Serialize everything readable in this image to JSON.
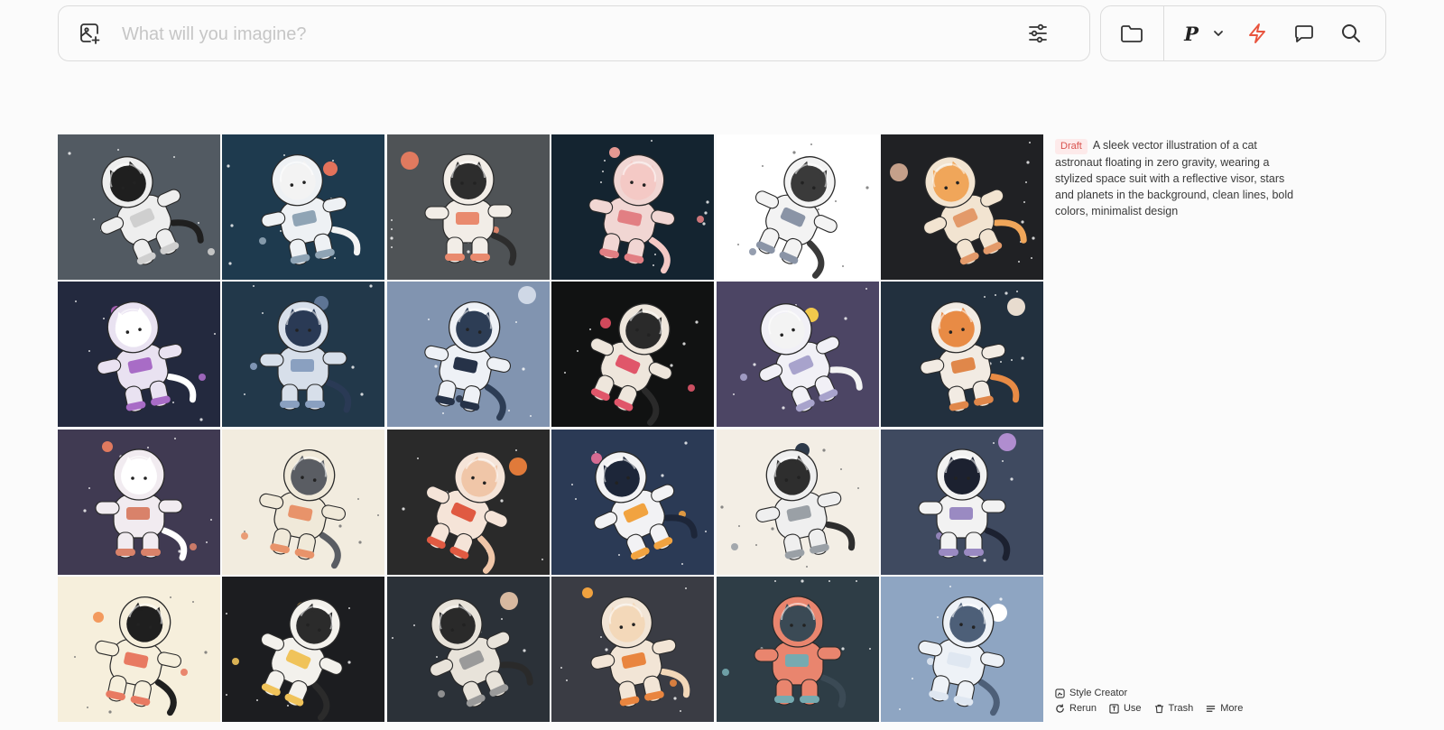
{
  "search": {
    "placeholder": "What will you imagine?",
    "value": ""
  },
  "toolbar": {
    "model_letter": "P",
    "icons": [
      "image-add-icon",
      "sliders-icon",
      "folder-icon",
      "chevron-down-icon",
      "lightning-icon",
      "chat-bubble-icon",
      "search-icon"
    ],
    "accent": "#e8543e"
  },
  "job": {
    "badge": "Draft",
    "prompt": "A sleek vector illustration of a cat astronaut floating in zero gravity, wearing a stylized space suit with a reflective visor, stars and planets in the background, clean lines, bold colors, minimalist design"
  },
  "actions": {
    "style_creator": "Style Creator",
    "rerun": "Rerun",
    "use": "Use",
    "trash": "Trash",
    "more": "More"
  },
  "images": [
    {
      "bg": "#525a62",
      "suit": "#eeeeee",
      "cat": "#1f1f1f",
      "accent": "#cfcfcf",
      "planet": "#9aa3ab"
    },
    {
      "bg": "#1e3a4e",
      "suit": "#eef1f4",
      "cat": "#f3f3f3",
      "accent": "#8fa4b5",
      "planet": "#e2725b"
    },
    {
      "bg": "#4f5356",
      "suit": "#f2ede7",
      "cat": "#2d2d2d",
      "accent": "#e98a6e",
      "planet": "#e07a5f"
    },
    {
      "bg": "#142430",
      "suit": "#f1d6d3",
      "cat": "#f4c9c5",
      "accent": "#e27f83",
      "planet": "#e59892"
    },
    {
      "bg": "#ffffff",
      "suit": "#f3f3f3",
      "cat": "#3a3a3a",
      "accent": "#8a94a6",
      "planet": "#c7cdd8"
    },
    {
      "bg": "#202124",
      "suit": "#f2e4d1",
      "cat": "#f0a65a",
      "accent": "#e39a6a",
      "planet": "#c5a08a"
    },
    {
      "bg": "#23293e",
      "suit": "#e9e2f1",
      "cat": "#ffffff",
      "accent": "#a86cc6",
      "planet": "#a35fb0"
    },
    {
      "bg": "#22384a",
      "suit": "#d7dfea",
      "cat": "#2a3a55",
      "accent": "#8aa0c0",
      "planet": "#5e7595"
    },
    {
      "bg": "#8194b0",
      "suit": "#eef1f6",
      "cat": "#2d3d55",
      "accent": "#263248",
      "planet": "#cfd8e6"
    },
    {
      "bg": "#111212",
      "suit": "#eee6dc",
      "cat": "#2a2a2a",
      "accent": "#e0566a",
      "planet": "#d1495b"
    },
    {
      "bg": "#4c4564",
      "suit": "#f1f0f6",
      "cat": "#f3f3f3",
      "accent": "#a8a3cc",
      "planet": "#f2c94c"
    },
    {
      "bg": "#22303e",
      "suit": "#f2ebe3",
      "cat": "#e88b45",
      "accent": "#e0874a",
      "planet": "#e8dccf"
    },
    {
      "bg": "#403a52",
      "suit": "#f1ebf0",
      "cat": "#ffffff",
      "accent": "#d9826a",
      "planet": "#e07a5f"
    },
    {
      "bg": "#f2ecdf",
      "suit": "#f0e9d9",
      "cat": "#5a5d63",
      "accent": "#e8936a",
      "planet": "#f09257"
    },
    {
      "bg": "#2a2a2a",
      "suit": "#f5e4d8",
      "cat": "#f0c6a8",
      "accent": "#e05a42",
      "planet": "#e07a3a"
    },
    {
      "bg": "#2b3a55",
      "suit": "#f2f2f4",
      "cat": "#1d2639",
      "accent": "#f1a340",
      "planet": "#d56b93"
    },
    {
      "bg": "#f3eee5",
      "suit": "#efefef",
      "cat": "#2e2e2e",
      "accent": "#9aa0a6",
      "planet": "#2e3a4a"
    },
    {
      "bg": "#3f4a60",
      "suit": "#f2f2f2",
      "cat": "#1c2130",
      "accent": "#9a8ac2",
      "planet": "#b08dcf"
    },
    {
      "bg": "#f6efdc",
      "suit": "#f6efdc",
      "cat": "#1f1f1f",
      "accent": "#e87a62",
      "planet": "#f39a5e"
    },
    {
      "bg": "#1c1d20",
      "suit": "#f3f1ec",
      "cat": "#2b2b2b",
      "accent": "#f0c35a",
      "planet": "#e9b84f"
    },
    {
      "bg": "#2b3138",
      "suit": "#e8e3da",
      "cat": "#2a2a2a",
      "accent": "#9a9a9a",
      "planet": "#d8b9a0"
    },
    {
      "bg": "#3a3c44",
      "suit": "#f2e5d6",
      "cat": "#f3d8b9",
      "accent": "#e9853f",
      "planet": "#f0a23f"
    },
    {
      "bg": "#2e3d46",
      "suit": "#e9856e",
      "cat": "#3b4a55",
      "accent": "#76aab0",
      "planet": "#f2a28c"
    },
    {
      "bg": "#8ea5c2",
      "suit": "#eef2f7",
      "cat": "#4d5f78",
      "accent": "#dfe7f1",
      "planet": "#ffffff"
    }
  ]
}
